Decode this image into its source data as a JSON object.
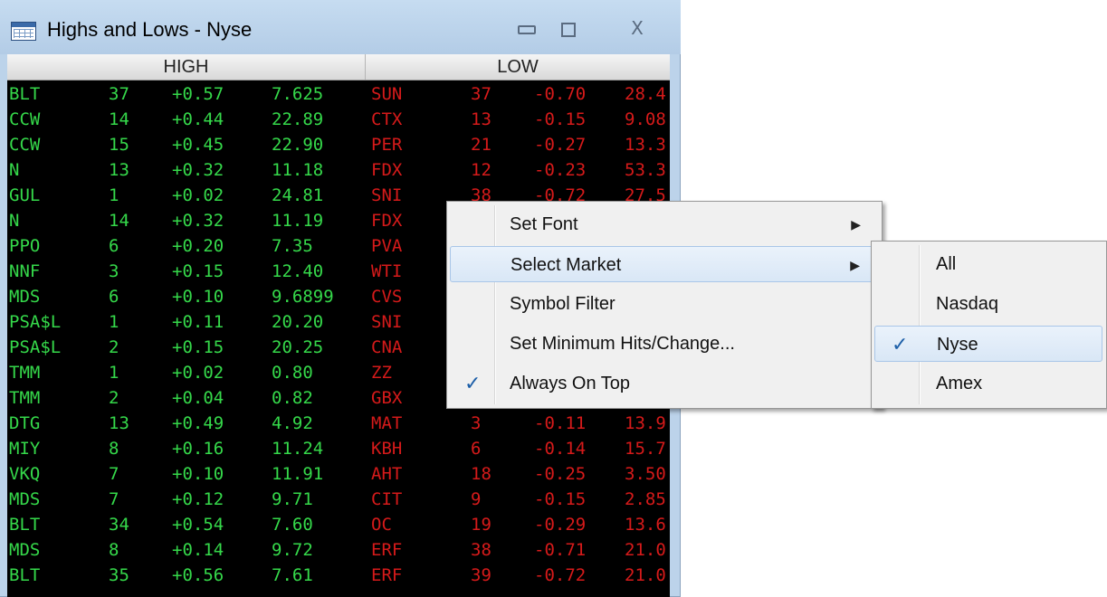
{
  "window": {
    "title": "Highs and Lows - Nyse",
    "buttons": {
      "minimize": "minimize",
      "maximize": "maximize",
      "close": "X"
    }
  },
  "columns": {
    "high": "HIGH",
    "low": "LOW"
  },
  "colors": {
    "high": "#35d84a",
    "low": "#d51a1a",
    "background": "#000000"
  },
  "rows": [
    {
      "h_sym": "BLT",
      "h_hits": "37",
      "h_chg": "+0.57",
      "h_price": "7.625",
      "l_sym": "SUN",
      "l_hits": "37",
      "l_chg": "-0.70",
      "l_price": "28.4"
    },
    {
      "h_sym": "CCW",
      "h_hits": "14",
      "h_chg": "+0.44",
      "h_price": "22.89",
      "l_sym": "CTX",
      "l_hits": "13",
      "l_chg": "-0.15",
      "l_price": "9.08"
    },
    {
      "h_sym": "CCW",
      "h_hits": "15",
      "h_chg": "+0.45",
      "h_price": "22.90",
      "l_sym": "PER",
      "l_hits": "21",
      "l_chg": "-0.27",
      "l_price": "13.3"
    },
    {
      "h_sym": "N",
      "h_hits": "13",
      "h_chg": "+0.32",
      "h_price": "11.18",
      "l_sym": "FDX",
      "l_hits": "12",
      "l_chg": "-0.23",
      "l_price": "53.3"
    },
    {
      "h_sym": "GUL",
      "h_hits": "1",
      "h_chg": "+0.02",
      "h_price": "24.81",
      "l_sym": "SNI",
      "l_hits": "38",
      "l_chg": "-0.72",
      "l_price": "27.5"
    },
    {
      "h_sym": "N",
      "h_hits": "14",
      "h_chg": "+0.32",
      "h_price": "11.19",
      "l_sym": "FDX",
      "l_hits": "",
      "l_chg": "",
      "l_price": ""
    },
    {
      "h_sym": "PPO",
      "h_hits": "6",
      "h_chg": "+0.20",
      "h_price": "7.35",
      "l_sym": "PVA",
      "l_hits": "",
      "l_chg": "",
      "l_price": ""
    },
    {
      "h_sym": "NNF",
      "h_hits": "3",
      "h_chg": "+0.15",
      "h_price": "12.40",
      "l_sym": "WTI",
      "l_hits": "",
      "l_chg": "",
      "l_price": ""
    },
    {
      "h_sym": "MDS",
      "h_hits": "6",
      "h_chg": "+0.10",
      "h_price": "9.6899",
      "l_sym": "CVS",
      "l_hits": "",
      "l_chg": "",
      "l_price": ""
    },
    {
      "h_sym": "PSA$L",
      "h_hits": "1",
      "h_chg": "+0.11",
      "h_price": "20.20",
      "l_sym": "SNI",
      "l_hits": "",
      "l_chg": "",
      "l_price": ""
    },
    {
      "h_sym": "PSA$L",
      "h_hits": "2",
      "h_chg": "+0.15",
      "h_price": "20.25",
      "l_sym": "CNA",
      "l_hits": "",
      "l_chg": "",
      "l_price": ""
    },
    {
      "h_sym": "TMM",
      "h_hits": "1",
      "h_chg": "+0.02",
      "h_price": "0.80",
      "l_sym": "ZZ",
      "l_hits": "",
      "l_chg": "",
      "l_price": ""
    },
    {
      "h_sym": "TMM",
      "h_hits": "2",
      "h_chg": "+0.04",
      "h_price": "0.82",
      "l_sym": "GBX",
      "l_hits": "",
      "l_chg": "",
      "l_price": ""
    },
    {
      "h_sym": "DTG",
      "h_hits": "13",
      "h_chg": "+0.49",
      "h_price": "4.92",
      "l_sym": "MAT",
      "l_hits": "3",
      "l_chg": "-0.11",
      "l_price": "13.9"
    },
    {
      "h_sym": "MIY",
      "h_hits": "8",
      "h_chg": "+0.16",
      "h_price": "11.24",
      "l_sym": "KBH",
      "l_hits": "6",
      "l_chg": "-0.14",
      "l_price": "15.7"
    },
    {
      "h_sym": "VKQ",
      "h_hits": "7",
      "h_chg": "+0.10",
      "h_price": "11.91",
      "l_sym": "AHT",
      "l_hits": "18",
      "l_chg": "-0.25",
      "l_price": "3.50"
    },
    {
      "h_sym": "MDS",
      "h_hits": "7",
      "h_chg": "+0.12",
      "h_price": "9.71",
      "l_sym": "CIT",
      "l_hits": "9",
      "l_chg": "-0.15",
      "l_price": "2.85"
    },
    {
      "h_sym": "BLT",
      "h_hits": "34",
      "h_chg": "+0.54",
      "h_price": "7.60",
      "l_sym": "OC",
      "l_hits": "19",
      "l_chg": "-0.29",
      "l_price": "13.6"
    },
    {
      "h_sym": "MDS",
      "h_hits": "8",
      "h_chg": "+0.14",
      "h_price": "9.72",
      "l_sym": "ERF",
      "l_hits": "38",
      "l_chg": "-0.71",
      "l_price": "21.0"
    },
    {
      "h_sym": "BLT",
      "h_hits": "35",
      "h_chg": "+0.56",
      "h_price": "7.61",
      "l_sym": "ERF",
      "l_hits": "39",
      "l_chg": "-0.72",
      "l_price": "21.0"
    }
  ],
  "context_menu": {
    "items": [
      {
        "label": "Set Font",
        "has_submenu": true,
        "checked": false
      },
      {
        "label": "Select Market",
        "has_submenu": true,
        "checked": false,
        "highlighted": true
      },
      {
        "label": "Symbol Filter",
        "has_submenu": false,
        "checked": false
      },
      {
        "label": "Set Minimum Hits/Change...",
        "has_submenu": false,
        "checked": false
      },
      {
        "label": "Always On Top",
        "has_submenu": false,
        "checked": true
      }
    ],
    "check_glyph": "✓",
    "arrow_glyph": "▶"
  },
  "submenu": {
    "items": [
      {
        "label": "All",
        "checked": false
      },
      {
        "label": "Nasdaq",
        "checked": false
      },
      {
        "label": "Nyse",
        "checked": true,
        "highlighted": true
      },
      {
        "label": "Amex",
        "checked": false
      }
    ]
  }
}
